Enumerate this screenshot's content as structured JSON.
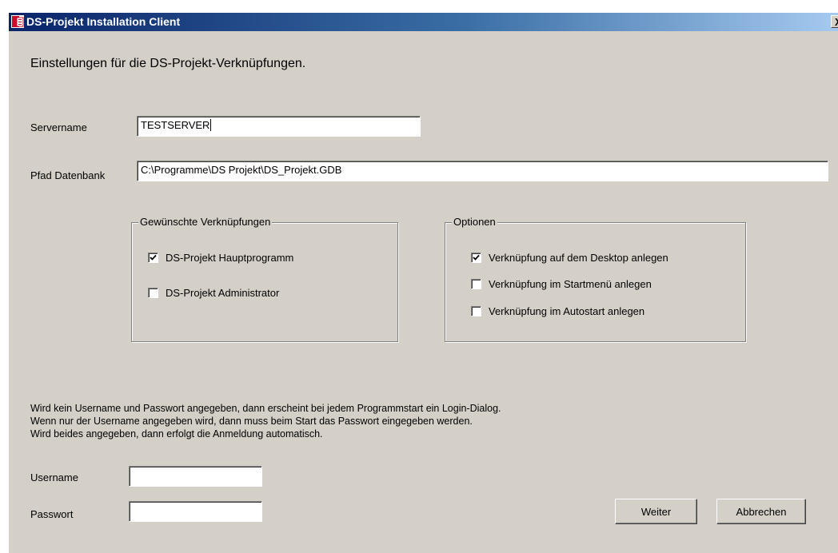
{
  "window": {
    "title": "DS-Projekt Installation Client",
    "close_label": "X"
  },
  "heading": "Einstellungen für die DS-Projekt-Verknüpfungen.",
  "server": {
    "label": "Servername",
    "value": "TESTSERVER"
  },
  "database": {
    "label": "Pfad Datenbank",
    "value": "C:\\Programme\\DS Projekt\\DS_Projekt.GDB"
  },
  "shortcuts_group": {
    "legend": "Gewünschte Verknüpfungen",
    "items": [
      {
        "label": "DS-Projekt Hauptprogramm",
        "checked": true
      },
      {
        "label": "DS-Projekt Administrator",
        "checked": false
      }
    ]
  },
  "options_group": {
    "legend": "Optionen",
    "items": [
      {
        "label": "Verknüpfung auf dem Desktop anlegen",
        "checked": true
      },
      {
        "label": "Verknüpfung im Startmenü anlegen",
        "checked": false
      },
      {
        "label": "Verknüpfung im Autostart anlegen",
        "checked": false
      }
    ]
  },
  "info": {
    "line1": "Wird kein Username und Passwort angegeben, dann erscheint bei jedem Programmstart ein Login-Dialog.",
    "line2": "Wenn nur der Username angegeben wird, dann muss beim Start das Passwort eingegeben werden.",
    "line3": "Wird beides angegeben, dann erfolgt die Anmeldung automatisch."
  },
  "username": {
    "label": "Username",
    "value": ""
  },
  "password": {
    "label": "Passwort",
    "value": ""
  },
  "buttons": {
    "next": "Weiter",
    "cancel": "Abbrechen"
  },
  "colors": {
    "titlebar_start": "#0a246a",
    "titlebar_end": "#a6caf0",
    "face": "#d4d0c8"
  }
}
